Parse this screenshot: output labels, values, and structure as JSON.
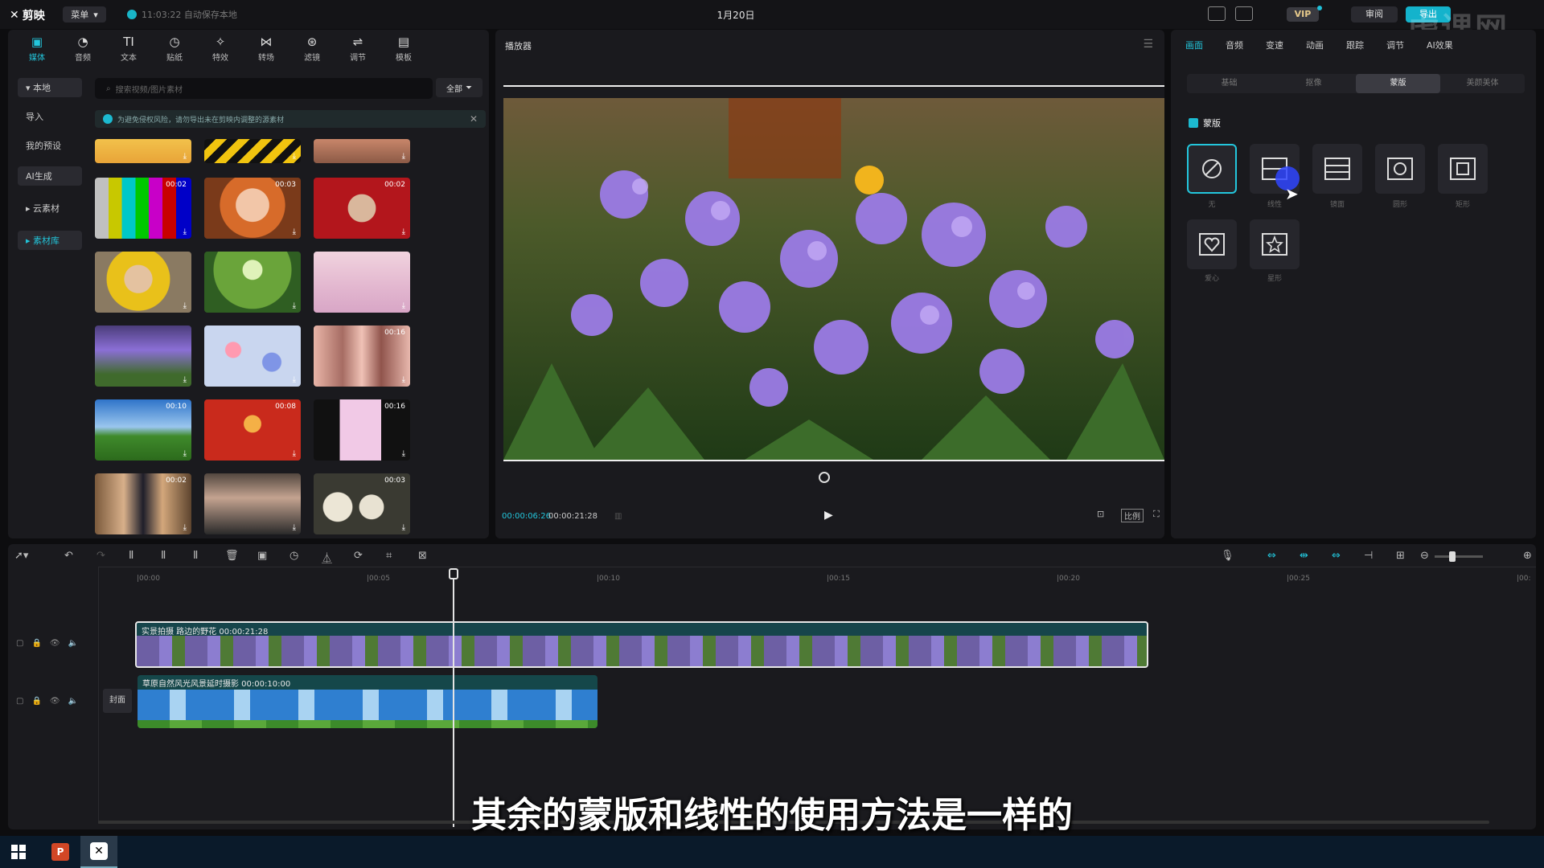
{
  "topbar": {
    "logo": "剪映",
    "menu_label": "菜单",
    "autosave": "11:03:22 自动保存本地",
    "title": "1月20日",
    "vip": "VIP",
    "review": "审阅",
    "export": "导出",
    "watermark": "虎课网"
  },
  "media": {
    "tabs": [
      {
        "label": "媒体",
        "icon": "media-icon"
      },
      {
        "label": "音频",
        "icon": "audio-icon"
      },
      {
        "label": "文本",
        "icon": "text-icon"
      },
      {
        "label": "贴纸",
        "icon": "sticker-icon"
      },
      {
        "label": "特效",
        "icon": "effects-icon"
      },
      {
        "label": "转场",
        "icon": "transition-icon"
      },
      {
        "label": "滤镜",
        "icon": "filter-icon"
      },
      {
        "label": "调节",
        "icon": "adjust-icon"
      },
      {
        "label": "模板",
        "icon": "template-icon"
      }
    ],
    "sidebar": [
      "▾ 本地",
      "导入",
      "我的预设",
      "AI生成",
      "▸ 云素材",
      "▸ 素材库"
    ],
    "search_placeholder": "搜索视频/图片素材",
    "filter_label": "全部",
    "notice": "为避免侵权风险，请勿导出未在剪映内调整的源素材",
    "thumbs_durations": [
      "",
      "",
      "",
      "00:02",
      "00:03",
      "00:02",
      "",
      "",
      "",
      "",
      "",
      "00:16",
      "00:10",
      "00:08",
      "00:16",
      "00:02",
      "",
      "00:03"
    ]
  },
  "player": {
    "title": "播放器",
    "current_time": "00:00:06:26",
    "total_time": "00:00:21:28",
    "ratio_label": "比例"
  },
  "right": {
    "tabs": [
      "画面",
      "音频",
      "变速",
      "动画",
      "跟踪",
      "调节",
      "AI效果"
    ],
    "subtabs": [
      "基础",
      "抠像",
      "蒙版",
      "美颜美体"
    ],
    "mask_header": "蒙版",
    "masks": [
      {
        "label": "无",
        "icon": "none-mask-icon"
      },
      {
        "label": "线性",
        "icon": "linear-mask-icon"
      },
      {
        "label": "镜面",
        "icon": "mirror-mask-icon"
      },
      {
        "label": "圆形",
        "icon": "circle-mask-icon"
      },
      {
        "label": "矩形",
        "icon": "rect-mask-icon"
      },
      {
        "label": "爱心",
        "icon": "heart-mask-icon"
      },
      {
        "label": "星形",
        "icon": "star-mask-icon"
      }
    ]
  },
  "timeline": {
    "ruler": [
      "|00:00",
      "|00:05",
      "|00:10",
      "|00:15",
      "|00:20",
      "|00:25",
      "|00:"
    ],
    "clip1_label": "实景拍摄 路边的野花  00:00:21:28",
    "clip2_label": "草原自然风光风景延时摄影  00:00:10:00",
    "cover_label": "封面"
  },
  "subtitle": "其余的蒙版和线性的使用方法是一样的",
  "colors": {
    "accent": "#23c6dc",
    "bg": "#0d0d0f",
    "panel": "#1a1a1e"
  }
}
